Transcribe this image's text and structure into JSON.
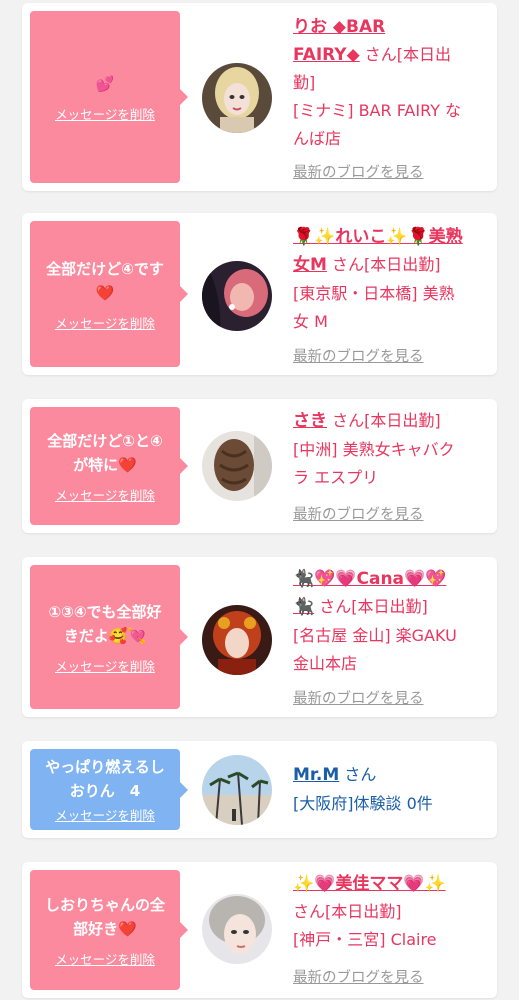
{
  "colors": {
    "pink_bubble": "#fc8a9e",
    "blue_bubble": "#80b3f2",
    "name_pink": "#e8365f",
    "name_blue": "#1a5ea8",
    "blog_gray": "#999999"
  },
  "common": {
    "delete_label": "メッセージを削除",
    "blog_label": "最新のブログを見る"
  },
  "cards": [
    {
      "message": "💕",
      "name_line1": "りお ◆BAR",
      "name_line2": "FAIRY◆",
      "suffix_line2": " さん[本日出",
      "suffix_line3": "勤]",
      "shop_line1": "[ミナミ] BAR FAIRY な",
      "shop_line2": "んば店"
    },
    {
      "message": "全部だけど④です\n❤️",
      "name_line1": "🌹✨れいこ✨🌹美熟",
      "name_line2": "女M",
      "suffix_line2": " さん[本日出勤]",
      "shop_line1": "[東京駅・日本橋] 美熟",
      "shop_line2": "女 M"
    },
    {
      "message": "全部だけど①と④\nが特に❤️",
      "name_line1": "さき",
      "suffix_line1": " さん[本日出勤]",
      "shop_line1": "[中洲] 美熟女キャバク",
      "shop_line2": "ラ エスプリ"
    },
    {
      "message": "①③④でも全部好\nきだよ🥰💘",
      "name_line1": "🐈‍⬛💖💗Cana💗💖",
      "name_line2": "🐈‍⬛",
      "suffix_line2": " さん[本日出勤]",
      "shop_line1": "[名古屋 金山] 楽GAKU",
      "shop_line2": "金山本店"
    },
    {
      "message": "やっぱり燃えるし\nおりん　4",
      "name_line1": "Mr.M",
      "suffix_line1": " さん",
      "shop_line1": "[大阪府]体験談 0件"
    },
    {
      "message": "しおりちゃんの全\n部好き❤️",
      "name_line1": "✨💗美佳ママ💗✨",
      "suffix_line2": "さん[本日出勤]",
      "shop_line1": "[神戸・三宮] Claire"
    }
  ]
}
